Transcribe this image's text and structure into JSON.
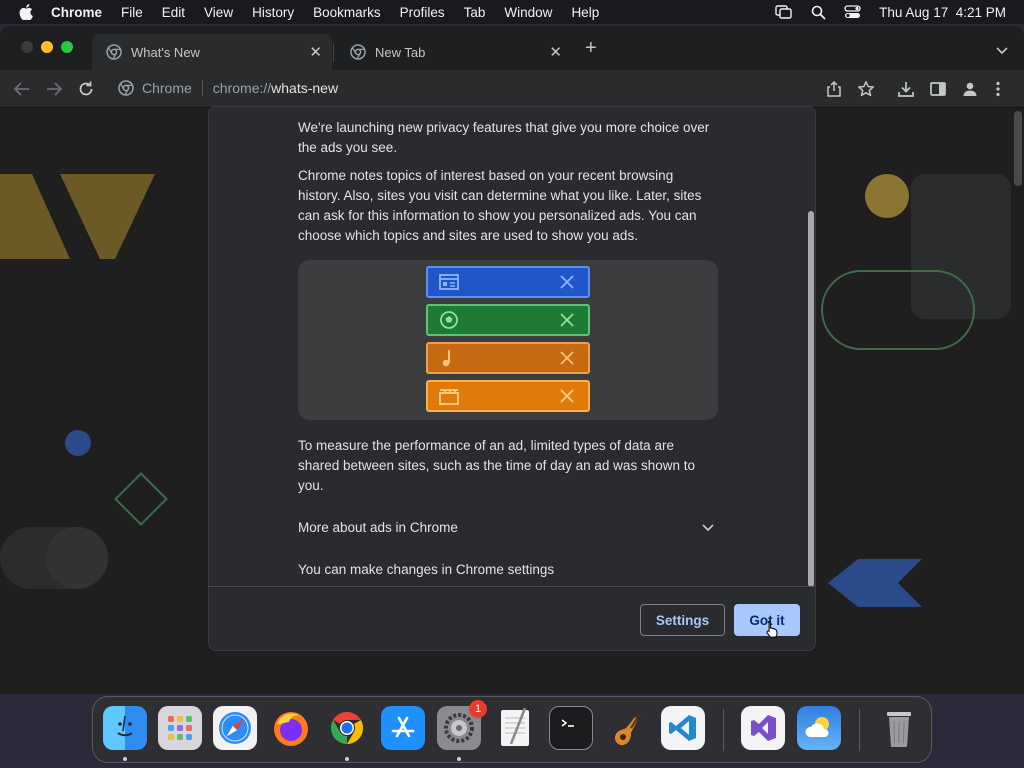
{
  "menubar": {
    "items": [
      "Chrome",
      "File",
      "Edit",
      "View",
      "History",
      "Bookmarks",
      "Profiles",
      "Tab",
      "Window",
      "Help"
    ],
    "datetime": "Thu Aug 17  4:21 PM"
  },
  "browser": {
    "tabs": [
      {
        "title": "What's New",
        "active": true
      },
      {
        "title": "New Tab",
        "active": false
      }
    ],
    "omnibox": {
      "chip": "Chrome",
      "scheme": "chrome://",
      "host": "whats-new"
    }
  },
  "dialog": {
    "paragraph1": "We're launching new privacy features that give you more choice over the ads you see.",
    "paragraph2": "Chrome notes topics of interest based on your recent browsing history. Also, sites you visit can determine what you like. Later, sites can ask for this information to show you personalized ads. You can choose which topics and sites are used to show you ads.",
    "topics": [
      {
        "icon": "news-icon",
        "color": "#1f57c8"
      },
      {
        "icon": "soccer-ball-icon",
        "color": "#1e7a34"
      },
      {
        "icon": "music-note-icon",
        "color": "#c56a10"
      },
      {
        "icon": "clapperboard-icon",
        "color": "#e07a0a"
      }
    ],
    "paragraph3": "To measure the performance of an ad, limited types of data are shared between sites, such as the time of day an ad was shown to you.",
    "expand_label": "More about ads in Chrome",
    "settings_text": "You can make changes in Chrome settings",
    "settings_button": "Settings",
    "gotit_button": "Got it"
  },
  "dock": {
    "apps": [
      "Finder",
      "Launchpad",
      "Safari",
      "Firefox",
      "Chrome",
      "App Store",
      "System Settings",
      "TextEdit",
      "Terminal",
      "GarageBand",
      "Visual Studio Code",
      "Visual Studio",
      "Weather",
      "Trash"
    ],
    "system_settings_badge": "1"
  },
  "colors": {
    "accent": "#a8c7fa",
    "dialog_bg": "#2a2b2e",
    "page_bg": "#1f1f1f"
  }
}
